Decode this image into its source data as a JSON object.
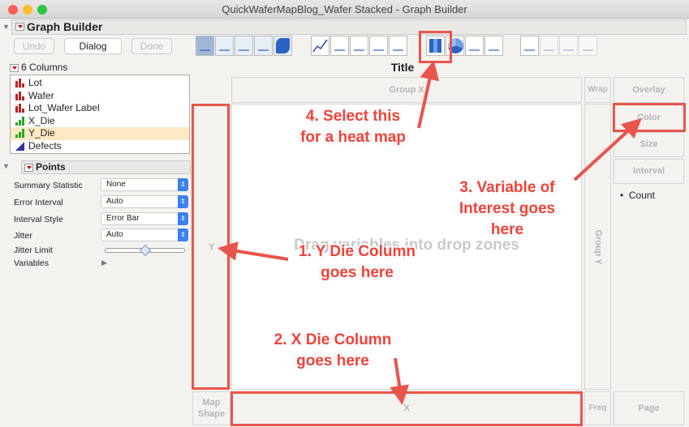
{
  "window": {
    "title": "QuickWaferMapBlog_Wafer Stacked - Graph Builder"
  },
  "header": {
    "title": "Graph Builder"
  },
  "buttons": {
    "undo": "Undo",
    "dialog": "Dialog",
    "done": "Done"
  },
  "toolbar": {
    "icons": [
      "points",
      "smoother",
      "line-of-fit",
      "ellipse",
      "contour",
      "line",
      "bar",
      "area",
      "box-plot",
      "histogram",
      "heatmap",
      "pie",
      "treemap",
      "mosaic",
      "caption-box",
      "formula",
      "map-shapes",
      "parallel"
    ],
    "selected": "heatmap"
  },
  "columns": {
    "header": "6 Columns",
    "items": [
      {
        "label": "Lot",
        "type": "nominal"
      },
      {
        "label": "Wafer",
        "type": "nominal"
      },
      {
        "label": "Lot_Wafer Label",
        "type": "nominal"
      },
      {
        "label": "X_Die",
        "type": "continuous"
      },
      {
        "label": "Y_Die",
        "type": "continuous",
        "selected": true
      },
      {
        "label": "Defects",
        "type": "ordinal"
      }
    ]
  },
  "points": {
    "header": "Points",
    "rows": [
      {
        "label": "Summary Statistic",
        "value": "None"
      },
      {
        "label": "Error Interval",
        "value": "Auto"
      },
      {
        "label": "Interval Style",
        "value": "Error Bar"
      },
      {
        "label": "Jitter",
        "value": "Auto"
      }
    ],
    "jitter_limit_label": "Jitter Limit",
    "jitter_limit_value": 0.5,
    "variables_label": "Variables"
  },
  "graph": {
    "title": "Title",
    "group_x": "Group X",
    "wrap": "Wrap",
    "overlay": "Overlay",
    "y": "Y",
    "placeholder": "Drag variables into drop zones",
    "group_y": "Group Y",
    "color": "Color",
    "size": "Size",
    "interval": "Interval",
    "legend_item": "Count",
    "map_shape": "Map Shape",
    "x": "X",
    "freq": "Freq",
    "page": "Page"
  },
  "annotations": {
    "a4": [
      "4. Select this",
      "for a heat map"
    ],
    "a3": [
      "3. Variable of",
      "Interest goes",
      "here"
    ],
    "a1": [
      "1. Y Die Column",
      "goes here"
    ],
    "a2": [
      "2. X Die Column",
      "goes here"
    ]
  },
  "colors": {
    "annotation": "#e8554b",
    "accent": "#3b82f0"
  }
}
